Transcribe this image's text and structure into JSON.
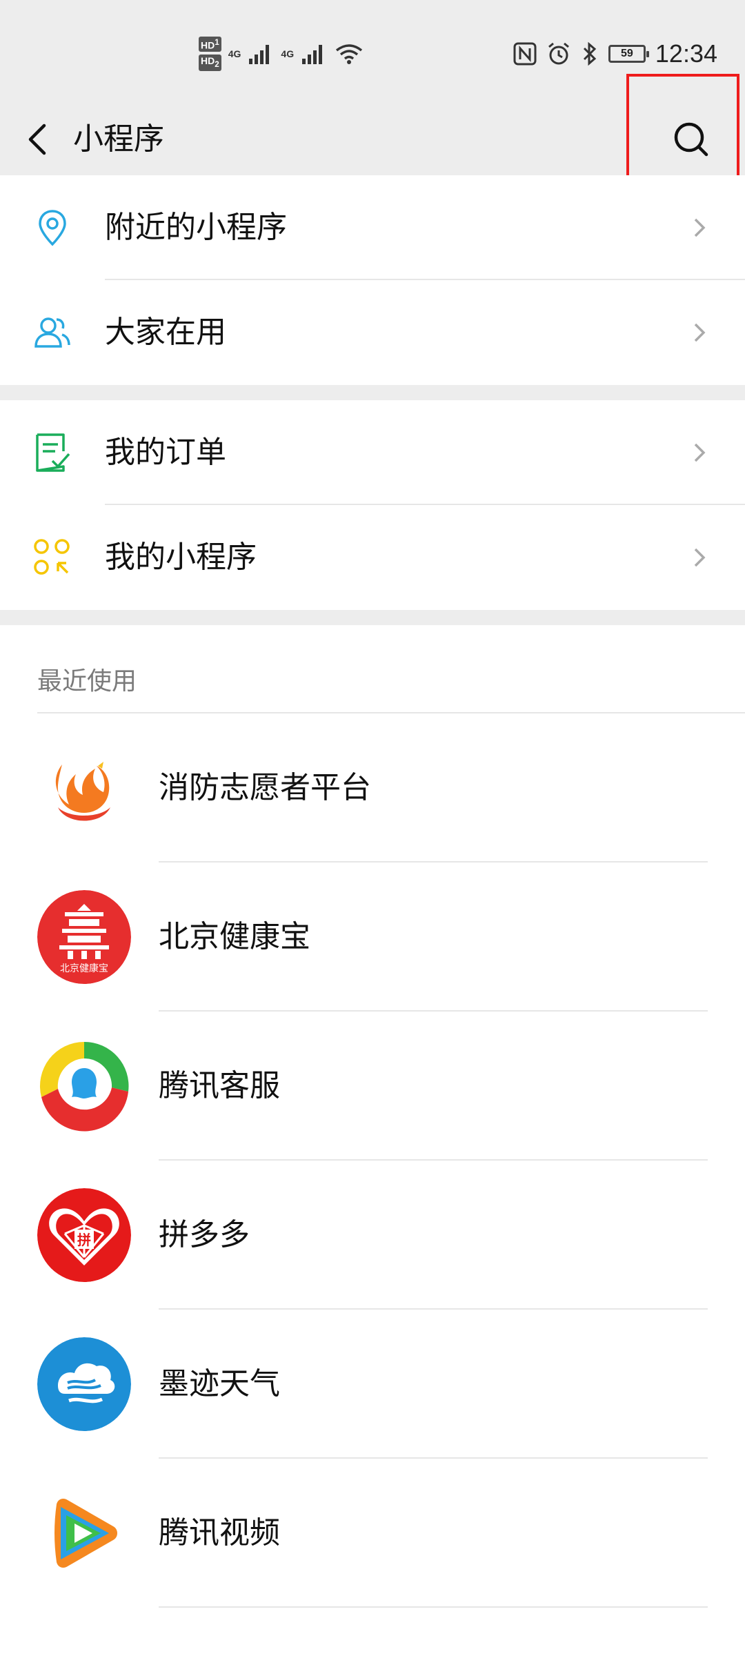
{
  "status_bar": {
    "hd1": "HD",
    "hd1_sub": "1",
    "hd2": "HD",
    "hd2_sub": "2",
    "net1": "4G",
    "net2": "4G",
    "battery_level": "59",
    "time": "12:34"
  },
  "header": {
    "title": "小程序",
    "back_icon": "chevron-left-icon",
    "search_icon": "search-icon"
  },
  "menu_group_1": [
    {
      "label": "附近的小程序",
      "icon": "location-pin-icon"
    },
    {
      "label": "大家在用",
      "icon": "users-icon"
    }
  ],
  "menu_group_2": [
    {
      "label": "我的订单",
      "icon": "order-checklist-icon"
    },
    {
      "label": "我的小程序",
      "icon": "mini-program-grid-icon"
    }
  ],
  "recent": {
    "title": "最近使用",
    "apps": [
      {
        "name": "消防志愿者平台",
        "icon": "fire-volunteer-logo"
      },
      {
        "name": "北京健康宝",
        "icon": "beijing-health-kit-logo",
        "icon_text": "北京健康宝"
      },
      {
        "name": "腾讯客服",
        "icon": "tencent-customer-service-logo"
      },
      {
        "name": "拼多多",
        "icon": "pinduoduo-logo",
        "icon_text": "拼"
      },
      {
        "name": "墨迹天气",
        "icon": "moji-weather-logo"
      },
      {
        "name": "腾讯视频",
        "icon": "tencent-video-logo"
      }
    ]
  },
  "colors": {
    "header_bg": "#ededed",
    "highlight": "#ef1c1c",
    "location_icon": "#29a8e0",
    "users_icon": "#29a8e0",
    "order_icon": "#1aad5a",
    "my_mp_icon": "#f5c500",
    "beijing_red": "#e62e2e",
    "pdd_red": "#e51a1a",
    "moji_blue": "#1d8fd6"
  }
}
